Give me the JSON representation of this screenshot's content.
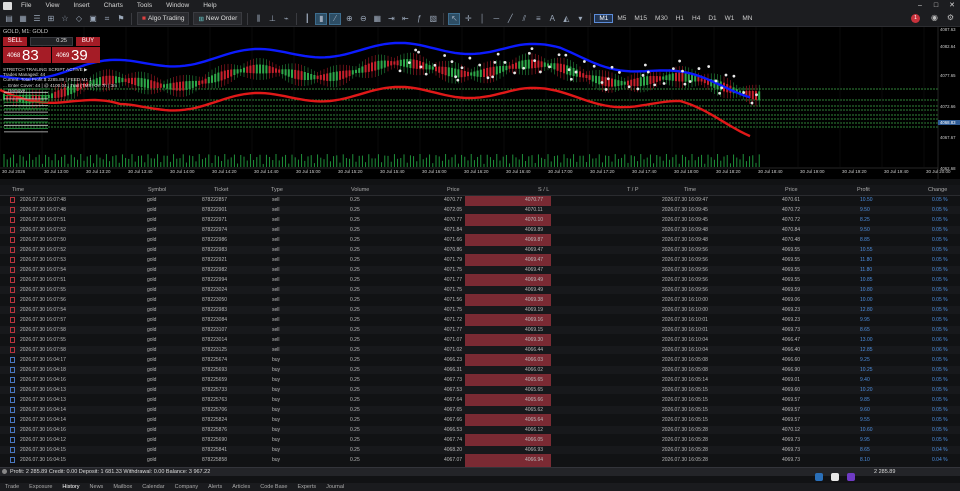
{
  "menu": [
    "File",
    "View",
    "Insert",
    "Charts",
    "Tools",
    "Window",
    "Help"
  ],
  "toolbar": {
    "algo": "Algo Trading",
    "new_order": "New Order",
    "timeframes": [
      "M1",
      "M5",
      "M15",
      "M30",
      "H1",
      "H4",
      "D1",
      "W1",
      "MN"
    ],
    "active_tf": "M1"
  },
  "chart": {
    "title": "GOLD, M1: GOLD",
    "sell_label": "SELL",
    "buy_label": "BUY",
    "lot": "0.25",
    "bid_small": "4068",
    "bid_big": "83",
    "ask_small": "4069",
    "ask_big": "39",
    "info_lines": [
      "STRETCH TRAILING SCRIPT ACTIVE ▶",
      "Trades Managed: 44",
      "Current: Total Profit $ 2285.89 | FEED M1 1",
      "... Enter Cover: 44 | @ 4100.04 | Trail (TMS) On 7h | 3m",
      "... Remove"
    ],
    "y_labels": [
      "4087.63",
      "4082.64",
      "4077.65",
      "4072.66",
      "4067.67",
      "4062.68"
    ],
    "price_marker": "4068.83",
    "x_labels": [
      "30 Jul 2026",
      "30 Jul 13:00",
      "30 Jul 13:20",
      "30 Jul 13:40",
      "30 Jul 14:00",
      "30 Jul 14:20",
      "30 Jul 14:40",
      "30 Jul 15:00",
      "30 Jul 15:20",
      "30 Jul 15:40",
      "30 Jul 16:00",
      "30 Jul 16:20",
      "30 Jul 16:40",
      "30 Jul 17:00",
      "30 Jul 17:20",
      "30 Jul 17:40",
      "30 Jul 18:00",
      "30 Jul 18:20",
      "30 Jul 18:40",
      "30 Jul 19:00",
      "30 Jul 19:20",
      "30 Jul 19:40",
      "30 Jul 20:00"
    ]
  },
  "columns": [
    "Time",
    "Symbol",
    "Ticket",
    "Type",
    "Volume",
    "Price",
    "S / L",
    "T / P",
    "Time",
    "Price",
    "Profit",
    "Change"
  ],
  "rows": [
    [
      "2026.07.30 16:07:48",
      "gold",
      "878222857",
      "sell",
      "0.25",
      "4070.77",
      "4070.77",
      "",
      "2026.07.30 16:09:47",
      "4070.61",
      "10.50",
      "0.05 %"
    ],
    [
      "2026.07.30 16:07:48",
      "gold",
      "878222901",
      "sell",
      "0.25",
      "4072.05",
      "4070.11",
      "",
      "2026.07.30 16:09:45",
      "4070.72",
      "9.50",
      "0.05 %"
    ],
    [
      "2026.07.30 16:07:51",
      "gold",
      "878222971",
      "sell",
      "0.25",
      "4070.77",
      "4070.10",
      "",
      "2026.07.30 16:09:45",
      "4070.72",
      "8.25",
      "0.05 %"
    ],
    [
      "2026.07.30 16:07:52",
      "gold",
      "878222974",
      "sell",
      "0.25",
      "4071.84",
      "4069.89",
      "",
      "2026.07.30 16:09:48",
      "4070.84",
      "9.50",
      "0.05 %"
    ],
    [
      "2026.07.30 16:07:50",
      "gold",
      "878222986",
      "sell",
      "0.25",
      "4071.66",
      "4069.87",
      "",
      "2026.07.30 16:09:48",
      "4070.48",
      "8.85",
      "0.05 %"
    ],
    [
      "2026.07.30 16:07:52",
      "gold",
      "878222983",
      "sell",
      "0.25",
      "4070.86",
      "4069.47",
      "",
      "2026.07.30 16:09:56",
      "4069.55",
      "10.55",
      "0.05 %"
    ],
    [
      "2026.07.30 16:07:53",
      "gold",
      "878222921",
      "sell",
      "0.25",
      "4071.79",
      "4069.47",
      "",
      "2026.07.30 16:09:56",
      "4069.55",
      "11.80",
      "0.05 %"
    ],
    [
      "2026.07.30 16:07:54",
      "gold",
      "878222982",
      "sell",
      "0.25",
      "4071.75",
      "4069.47",
      "",
      "2026.07.30 16:09:56",
      "4069.55",
      "11.80",
      "0.05 %"
    ],
    [
      "2026.07.30 16:07:51",
      "gold",
      "878222994",
      "sell",
      "0.25",
      "4071.77",
      "4069.49",
      "",
      "2026.07.30 16:09:56",
      "4069.55",
      "10.85",
      "0.05 %"
    ],
    [
      "2026.07.30 16:07:55",
      "gold",
      "878223024",
      "sell",
      "0.25",
      "4071.75",
      "4069.49",
      "",
      "2026.07.30 16:09:56",
      "4069.59",
      "10.80",
      "0.05 %"
    ],
    [
      "2026.07.30 16:07:56",
      "gold",
      "878223050",
      "sell",
      "0.25",
      "4071.56",
      "4069.38",
      "",
      "2026.07.30 16:10:00",
      "4069.06",
      "10.00",
      "0.05 %"
    ],
    [
      "2026.07.30 16:07:54",
      "gold",
      "878222983",
      "sell",
      "0.25",
      "4071.75",
      "4069.19",
      "",
      "2026.07.30 16:10:00",
      "4069.23",
      "12.80",
      "0.05 %"
    ],
    [
      "2026.07.30 16:07:57",
      "gold",
      "878223084",
      "sell",
      "0.25",
      "4071.72",
      "4069.16",
      "",
      "2026.07.30 16:10:01",
      "4069.23",
      "9.95",
      "0.05 %"
    ],
    [
      "2026.07.30 16:07:58",
      "gold",
      "878223107",
      "sell",
      "0.25",
      "4071.77",
      "4069.15",
      "",
      "2026.07.30 16:10:01",
      "4069.73",
      "8.65",
      "0.05 %"
    ],
    [
      "2026.07.30 16:07:55",
      "gold",
      "878223014",
      "sell",
      "0.25",
      "4071.07",
      "4069.30",
      "",
      "2026.07.30 16:10:04",
      "4066.47",
      "13.00",
      "0.06 %"
    ],
    [
      "2026.07.30 16:07:58",
      "gold",
      "878223125",
      "sell",
      "0.25",
      "4071.02",
      "4066.44",
      "",
      "2026.07.30 16:10:04",
      "4066.40",
      "12.85",
      "0.06 %"
    ],
    [
      "2026.07.30 16:04:17",
      "gold",
      "878225674",
      "buy",
      "0.25",
      "4066.23",
      "4066.03",
      "",
      "2026.07.30 16:05:08",
      "4066.60",
      "9.25",
      "0.05 %"
    ],
    [
      "2026.07.30 16:04:18",
      "gold",
      "878225693",
      "buy",
      "0.25",
      "4066.31",
      "4066.02",
      "",
      "2026.07.30 16:05:08",
      "4066.90",
      "10.25",
      "0.05 %"
    ],
    [
      "2026.07.30 16:04:16",
      "gold",
      "878225659",
      "buy",
      "0.25",
      "4067.73",
      "4065.65",
      "",
      "2026.07.30 16:05:14",
      "4069.01",
      "9.40",
      "0.05 %"
    ],
    [
      "2026.07.30 16:04:13",
      "gold",
      "878225733",
      "buy",
      "0.25",
      "4067.53",
      "4065.65",
      "",
      "2026.07.30 16:05:15",
      "4069.60",
      "10.20",
      "0.05 %"
    ],
    [
      "2026.07.30 16:04:13",
      "gold",
      "878225763",
      "buy",
      "0.25",
      "4067.64",
      "4065.66",
      "",
      "2026.07.30 16:05:15",
      "4069.57",
      "9.85",
      "0.05 %"
    ],
    [
      "2026.07.30 16:04:14",
      "gold",
      "878225706",
      "buy",
      "0.25",
      "4067.65",
      "4065.62",
      "",
      "2026.07.30 16:05:15",
      "4069.57",
      "9.60",
      "0.05 %"
    ],
    [
      "2026.07.30 16:04:14",
      "gold",
      "878225824",
      "buy",
      "0.25",
      "4067.66",
      "4065.64",
      "",
      "2026.07.30 16:05:15",
      "4069.57",
      "9.55",
      "0.05 %"
    ],
    [
      "2026.07.30 16:04:16",
      "gold",
      "878225876",
      "buy",
      "0.25",
      "4066.53",
      "4066.12",
      "",
      "2026.07.30 16:05:28",
      "4070.12",
      "10.60",
      "0.05 %"
    ],
    [
      "2026.07.30 16:04:12",
      "gold",
      "878225690",
      "buy",
      "0.25",
      "4067.74",
      "4066.05",
      "",
      "2026.07.30 16:05:28",
      "4069.73",
      "9.95",
      "0.05 %"
    ],
    [
      "2026.07.30 16:04:15",
      "gold",
      "878225841",
      "buy",
      "0.25",
      "4068.20",
      "4066.93",
      "",
      "2026.07.30 16:05:28",
      "4069.73",
      "8.65",
      "0.04 %"
    ],
    [
      "2026.07.30 16:04:15",
      "gold",
      "878225858",
      "buy",
      "0.25",
      "4067.07",
      "4066.94",
      "",
      "2026.07.30 16:05:28",
      "4069.73",
      "8.10",
      "0.04 %"
    ]
  ],
  "totals": {
    "text": "Profit: 2 285.89  Credit: 0.00  Deposit: 1 681.33  Withdrawal: 0.00  Balance: 3 967.22",
    "profit": "2 285.89"
  },
  "tabs": [
    "Trade",
    "Exposure",
    "History",
    "News",
    "Mailbox",
    "Calendar",
    "Company",
    "Alerts",
    "Articles",
    "Code Base",
    "Experts",
    "Journal"
  ],
  "active_tab": "History",
  "colors": {
    "sell_button": "#a51c26",
    "upper_band": "#0c1bff",
    "lower_band": "#e01818",
    "grid_green": "#3fb04a"
  }
}
